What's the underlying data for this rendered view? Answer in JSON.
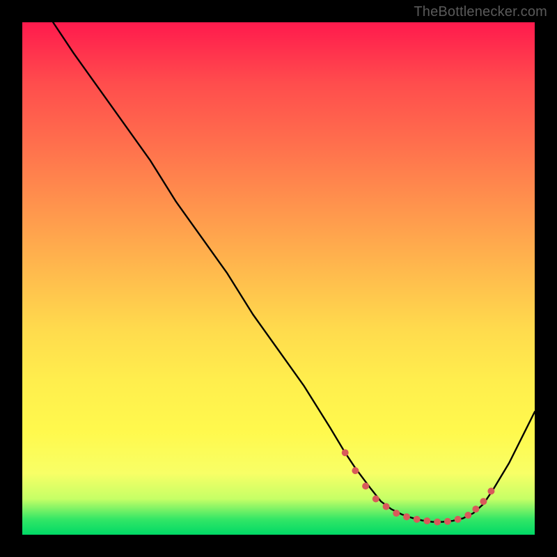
{
  "watermark": "TheBottlenecker.com",
  "chart_data": {
    "type": "line",
    "title": "",
    "xlabel": "",
    "ylabel": "",
    "xlim": [
      0,
      100
    ],
    "ylim": [
      0,
      100
    ],
    "series": [
      {
        "name": "curve",
        "x": [
          6,
          10,
          15,
          20,
          25,
          30,
          35,
          40,
          45,
          50,
          55,
          60,
          63,
          65,
          68,
          70,
          72,
          74,
          76,
          78,
          80,
          82,
          84,
          86,
          88,
          90,
          92,
          95,
          100
        ],
        "y": [
          100,
          94,
          87,
          80,
          73,
          65,
          58,
          51,
          43,
          36,
          29,
          21,
          16,
          13,
          9,
          6.5,
          5,
          4,
          3.3,
          2.8,
          2.5,
          2.5,
          2.7,
          3.2,
          4.2,
          6,
          9,
          14,
          24
        ]
      }
    ],
    "markers": {
      "name": "highlight-dots",
      "x": [
        63,
        65,
        67,
        69,
        71,
        73,
        75,
        77,
        79,
        81,
        83,
        85,
        87,
        88.5,
        90,
        91.5
      ],
      "y": [
        16,
        12.5,
        9.5,
        7,
        5.5,
        4.2,
        3.5,
        3,
        2.7,
        2.5,
        2.6,
        3,
        3.8,
        5,
        6.5,
        8.5
      ]
    },
    "colors": {
      "curve": "#000000",
      "markers": "#d85a5a",
      "gradient_top": "#ff1a4d",
      "gradient_mid": "#ffee4d",
      "gradient_bottom": "#00d966",
      "frame": "#000000"
    }
  }
}
